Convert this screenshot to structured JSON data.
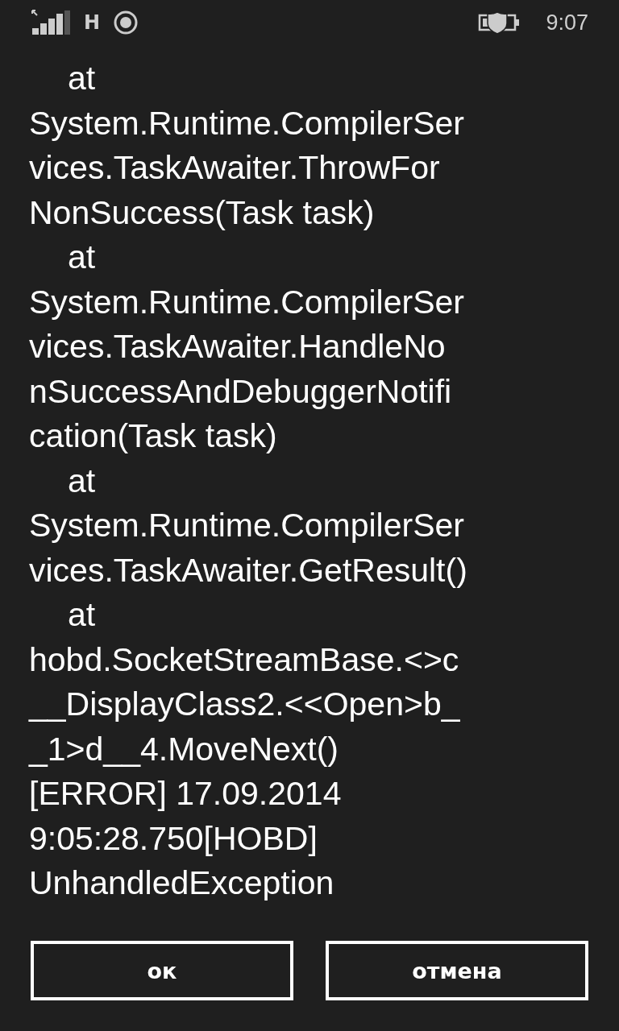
{
  "status_bar": {
    "network_type": "H",
    "time": "9:07"
  },
  "message": {
    "lines": [
      {
        "text": "at",
        "indented": true
      },
      {
        "text": "System.Runtime.CompilerSer",
        "indented": false
      },
      {
        "text": "vices.TaskAwaiter.ThrowFor",
        "indented": false
      },
      {
        "text": "NonSuccess(Task task)",
        "indented": false
      },
      {
        "text": "at",
        "indented": true
      },
      {
        "text": "System.Runtime.CompilerSer",
        "indented": false
      },
      {
        "text": "vices.TaskAwaiter.HandleNo",
        "indented": false
      },
      {
        "text": "nSuccessAndDebuggerNotifi",
        "indented": false
      },
      {
        "text": "cation(Task task)",
        "indented": false
      },
      {
        "text": "at",
        "indented": true
      },
      {
        "text": "System.Runtime.CompilerSer",
        "indented": false
      },
      {
        "text": "vices.TaskAwaiter.GetResult()",
        "indented": false
      },
      {
        "text": "at",
        "indented": true
      },
      {
        "text": "hobd.SocketStreamBase.<>c",
        "indented": false
      },
      {
        "text": "__DisplayClass2.<<Open>b_",
        "indented": false
      },
      {
        "text": "_1>d__4.MoveNext()",
        "indented": false
      },
      {
        "text": "[ERROR] 17.09.2014",
        "indented": false
      },
      {
        "text": "9:05:28.750[HOBD]",
        "indented": false
      },
      {
        "text": "UnhandledException",
        "indented": false
      }
    ]
  },
  "buttons": [
    {
      "label": "ок"
    },
    {
      "label": "отмена"
    }
  ]
}
